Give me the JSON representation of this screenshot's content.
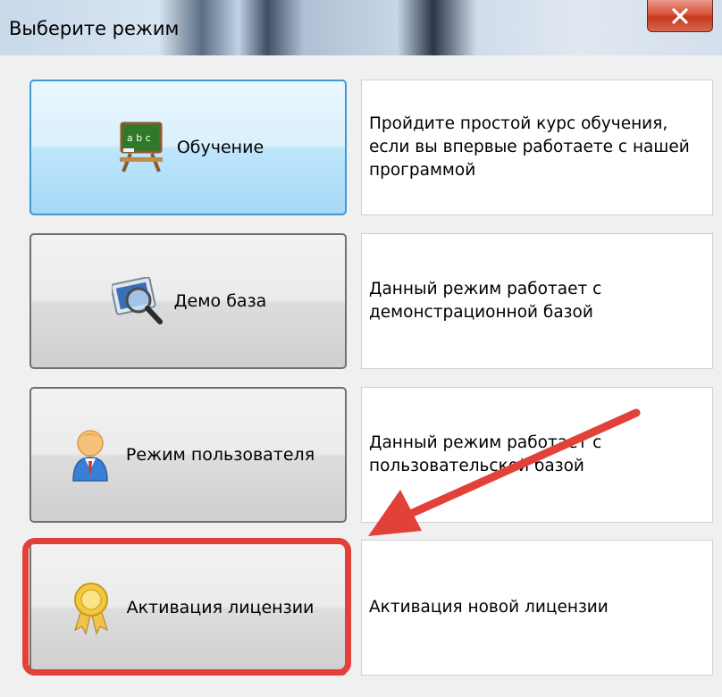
{
  "window": {
    "title": "Выберите режим",
    "close_symbol": "x"
  },
  "modes": [
    {
      "label": "Обучение",
      "icon": "chalkboard-icon",
      "description": "Пройдите простой курс обучения, если вы впервые работаете с нашей программой"
    },
    {
      "label": "Демо база",
      "icon": "magnifier-screen-icon",
      "description": "Данный режим работает с демонстрационной базой"
    },
    {
      "label": "Режим пользователя",
      "icon": "user-icon",
      "description": "Данный режим работает с пользовательской базой"
    },
    {
      "label": "Активация лицензии",
      "icon": "award-ribbon-icon",
      "description": "Активация новой лицензии"
    }
  ],
  "annotation": {
    "highlight_color": "#e2413a",
    "arrow_color": "#e2413a"
  },
  "chalkboard_text": "a b c"
}
